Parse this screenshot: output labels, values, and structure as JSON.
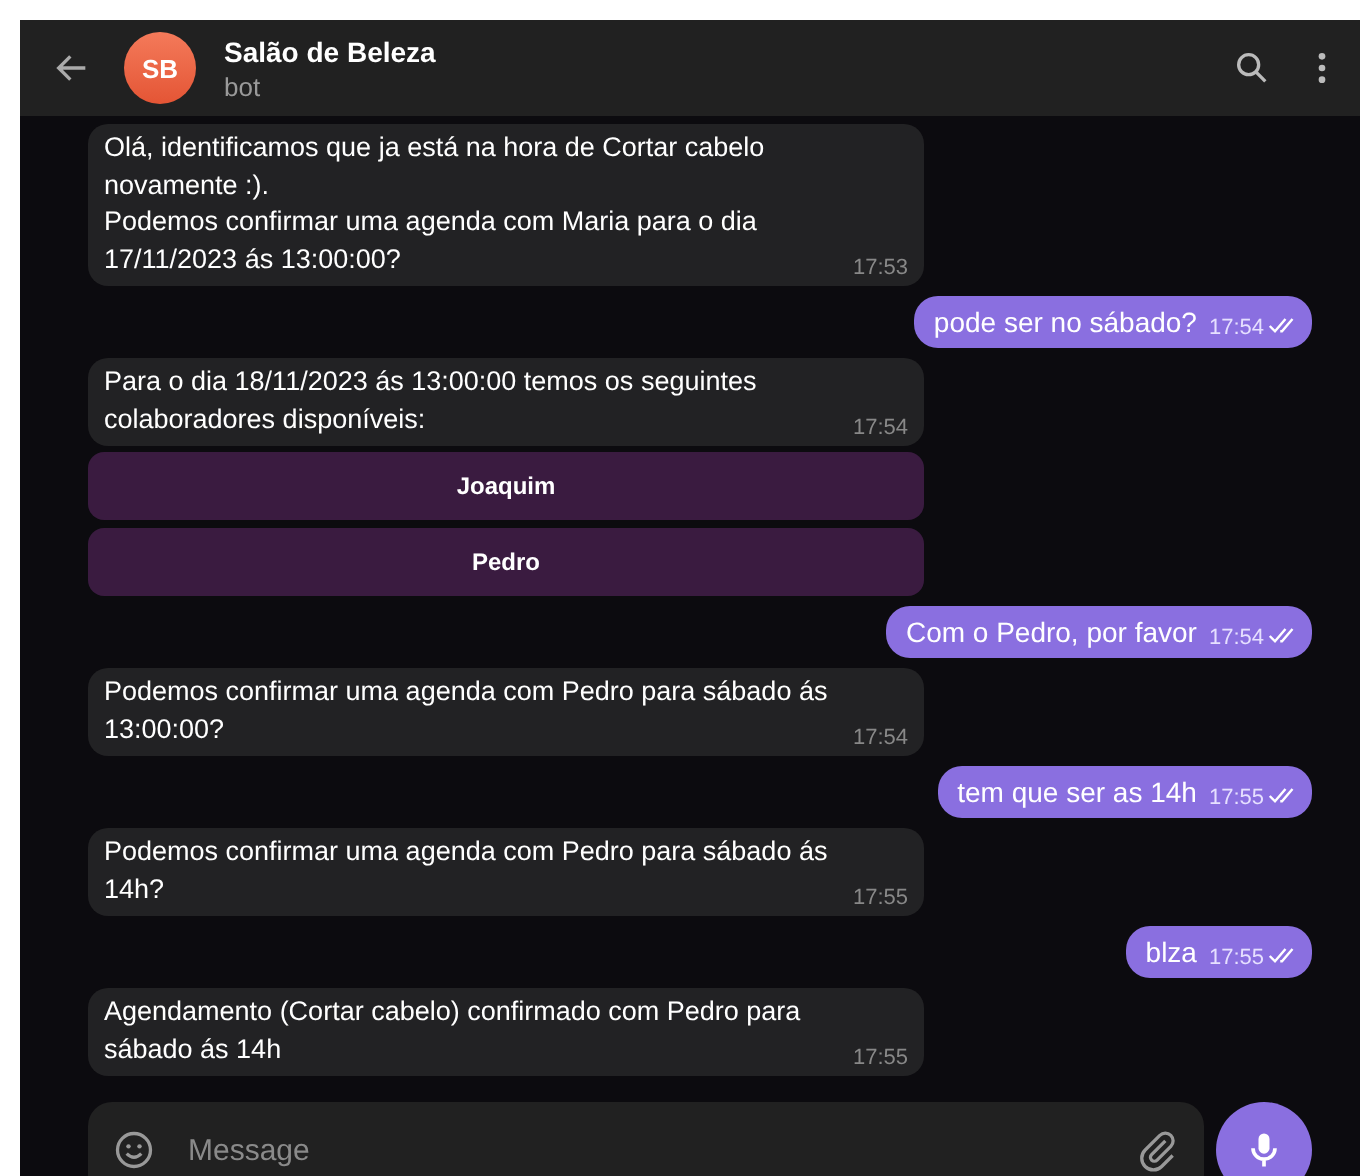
{
  "header": {
    "avatar": "SB",
    "title": "Salão de Beleza",
    "subtitle": "bot"
  },
  "messages": [
    {
      "kind": "in",
      "text": "Olá, identificamos que ja está na hora de Cortar cabelo\nnovamente :).\nPodemos confirmar uma agenda com Maria para o dia\n17/11/2023 ás 13:00:00?",
      "time": "17:53"
    },
    {
      "kind": "out",
      "text": "pode ser no sábado?",
      "time": "17:54",
      "read": true
    },
    {
      "kind": "in",
      "text": "Para o dia 18/11/2023 ás 13:00:00 temos os seguintes\ncolaboradores disponíveis:",
      "time": "17:54"
    },
    {
      "kind": "buttons",
      "buttons": [
        "Joaquim",
        "Pedro"
      ]
    },
    {
      "kind": "out",
      "text": "Com o Pedro, por favor",
      "time": "17:54",
      "read": true
    },
    {
      "kind": "in",
      "text": "Podemos confirmar uma agenda com Pedro para sábado ás\n13:00:00?",
      "time": "17:54"
    },
    {
      "kind": "out",
      "text": "tem que ser as 14h",
      "time": "17:55",
      "read": true
    },
    {
      "kind": "in",
      "text": "Podemos confirmar uma agenda com Pedro para sábado ás\n14h?",
      "time": "17:55"
    },
    {
      "kind": "out",
      "text": "blza",
      "time": "17:55",
      "read": true
    },
    {
      "kind": "in",
      "text": "Agendamento (Cortar cabelo) confirmado com Pedro para\nsábado ás 14h",
      "time": "17:55"
    }
  ],
  "composer": {
    "placeholder": "Message"
  }
}
